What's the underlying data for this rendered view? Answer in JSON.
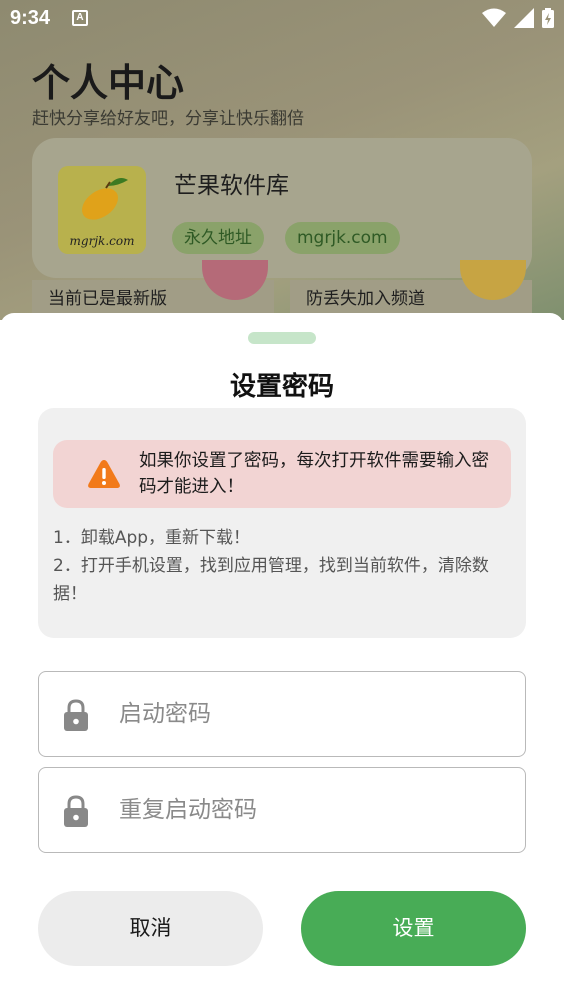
{
  "status_bar": {
    "time": "9:34",
    "badge": "A"
  },
  "background_page": {
    "title": "个人中心",
    "subtitle": "赶快分享给好友吧，分享让快乐翻倍",
    "app_card": {
      "logo_text": "mgrjk.com",
      "name": "芒果软件库",
      "tags": [
        "永久地址",
        "mgrjk.com"
      ]
    },
    "mini_cards": [
      "当前已是最新版",
      "防丢失加入频道"
    ]
  },
  "sheet": {
    "title": "设置密码",
    "warning": "如果你设置了密码，每次打开软件需要输入密码才能进入！",
    "tips": [
      "1．卸载App，重新下载！",
      "2．打开手机设置，找到应用管理，找到当前软件，清除数据！"
    ],
    "password_placeholder": "启动密码",
    "repeat_password_placeholder": "重复启动密码",
    "cancel_label": "取消",
    "confirm_label": "设置"
  },
  "icons": [
    "wifi-icon",
    "signal-icon",
    "battery-icon",
    "mango-icon",
    "warning-icon",
    "lock-icon"
  ],
  "colors": {
    "accent": "#48ac56",
    "warning": "#f27a1a",
    "warning_bg": "#f2d4d3",
    "handle": "#c6e5c9"
  }
}
